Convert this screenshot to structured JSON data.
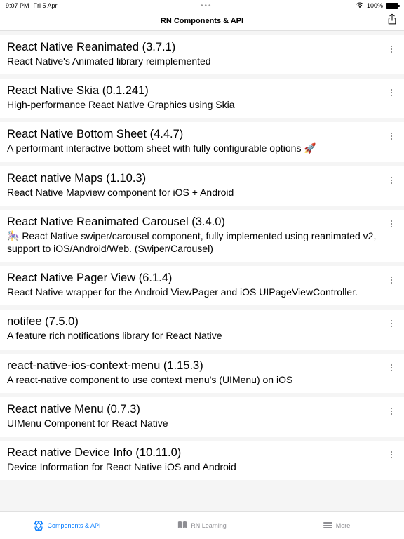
{
  "statusBar": {
    "time": "9:07 PM",
    "date": "Fri 5 Apr",
    "battery": "100%"
  },
  "nav": {
    "title": "RN Components & API"
  },
  "items": [
    {
      "title": "React Native Reanimated (3.7.1)",
      "desc": "React Native's Animated library reimplemented"
    },
    {
      "title": "React Native Skia (0.1.241)",
      "desc": "High-performance React Native Graphics using Skia"
    },
    {
      "title": "React Native Bottom Sheet (4.4.7)",
      "desc": "A performant interactive bottom sheet with fully configurable options 🚀"
    },
    {
      "title": "React native Maps (1.10.3)",
      "desc": "React Native Mapview component for iOS + Android"
    },
    {
      "title": "React Native Reanimated Carousel (3.4.0)",
      "desc": "🎠 React Native swiper/carousel component, fully implemented using reanimated v2, support to iOS/Android/Web. (Swiper/Carousel)"
    },
    {
      "title": "React Native Pager View (6.1.4)",
      "desc": "React Native wrapper for the Android ViewPager and iOS UIPageViewController."
    },
    {
      "title": "notifee (7.5.0)",
      "desc": "A feature rich notifications library for React Native"
    },
    {
      "title": "react-native-ios-context-menu (1.15.3)",
      "desc": "A react-native component to use context menu's (UIMenu) on iOS"
    },
    {
      "title": "React native Menu (0.7.3)",
      "desc": "UIMenu Component for React Native"
    },
    {
      "title": "React native Device Info (10.11.0)",
      "desc": "Device Information for React Native iOS and Android"
    }
  ],
  "tabs": {
    "components": "Components & API",
    "learning": "RN Learning",
    "more": "More"
  }
}
